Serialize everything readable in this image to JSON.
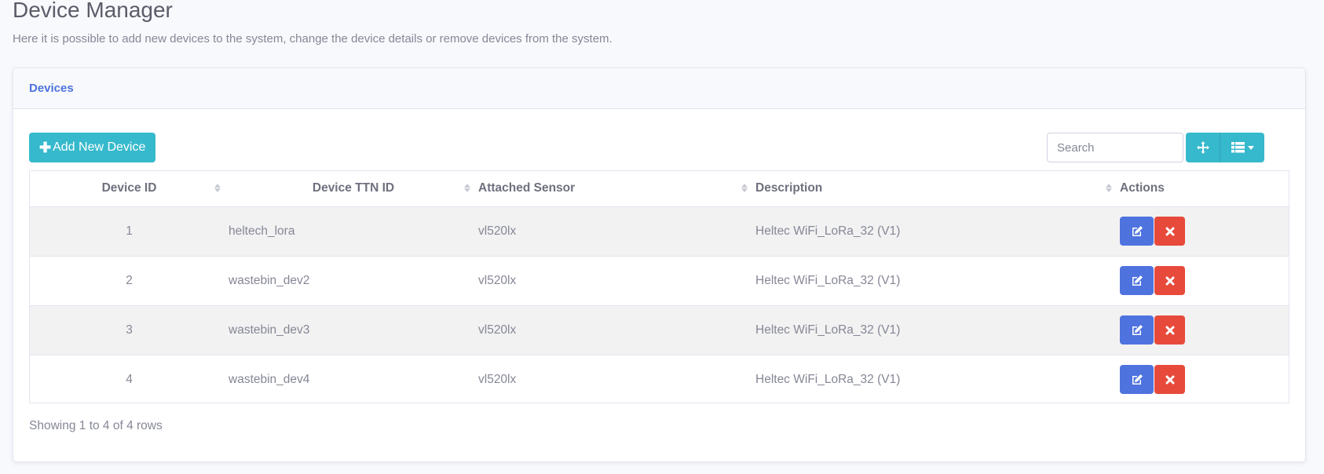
{
  "page": {
    "title": "Device Manager",
    "subtitle": "Here it is possible to add new devices to the system, change the device details or remove devices from the system."
  },
  "card": {
    "header": "Devices"
  },
  "toolbar": {
    "add_label": "Add New Device",
    "search_placeholder": "Search",
    "move_icon": "arrows-move-icon",
    "columns_icon": "list-columns-icon"
  },
  "table": {
    "headers": [
      "Device ID",
      "Device TTN ID",
      "Attached Sensor",
      "Description",
      "Actions"
    ],
    "rows": [
      {
        "id": "1",
        "ttn_id": "heltech_lora",
        "sensor": "vl520lx",
        "description": "Heltec WiFi_LoRa_32 (V1)"
      },
      {
        "id": "2",
        "ttn_id": "wastebin_dev2",
        "sensor": "vl520lx",
        "description": "Heltec WiFi_LoRa_32 (V1)"
      },
      {
        "id": "3",
        "ttn_id": "wastebin_dev3",
        "sensor": "vl520lx",
        "description": "Heltec WiFi_LoRa_32 (V1)"
      },
      {
        "id": "4",
        "ttn_id": "wastebin_dev4",
        "sensor": "vl520lx",
        "description": "Heltec WiFi_LoRa_32 (V1)"
      }
    ]
  },
  "footer": {
    "showing": "Showing 1 to 4 of 4 rows"
  },
  "colors": {
    "accent": "#36b9cc",
    "primary": "#4e73df",
    "danger": "#e74a3b"
  }
}
